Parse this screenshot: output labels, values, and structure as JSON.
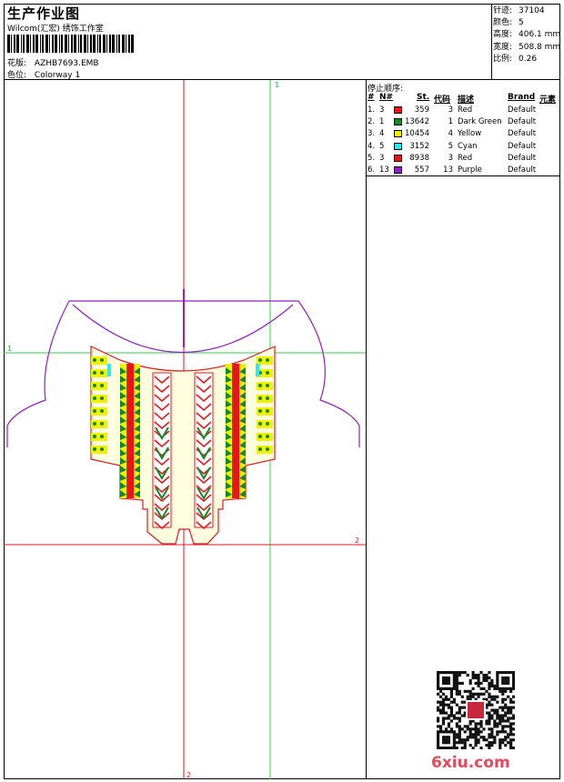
{
  "header": {
    "title": "生产作业图",
    "company": "Wilcom(汇宏) 绣饰工作室",
    "design_label": "花版:",
    "design_value": "AZHB7693.EMB",
    "color_label": "色位:",
    "color_value": "Colorway 1"
  },
  "stats": [
    {
      "label": "针迹:",
      "value": "37104"
    },
    {
      "label": "颜色:",
      "value": "5"
    },
    {
      "label": "高度:",
      "value": "406.1 mm"
    },
    {
      "label": "宽度:",
      "value": "508.8 mm"
    },
    {
      "label": "比例:",
      "value": "0.26"
    }
  ],
  "stop_sequence": {
    "title": "停止顺序:",
    "columns": [
      "#",
      "N#",
      "St.",
      "代码",
      "描述",
      "Brand",
      "元素"
    ],
    "rows": [
      {
        "idx": "1.",
        "needle": "3",
        "color": "#e8141a",
        "stitches": "359",
        "code": "3",
        "desc": "Red",
        "brand": "Default"
      },
      {
        "idx": "2.",
        "needle": "1",
        "color": "#14882c",
        "stitches": "13642",
        "code": "1",
        "desc": "Dark Green",
        "brand": "Default"
      },
      {
        "idx": "3.",
        "needle": "4",
        "color": "#f0f000",
        "stitches": "10454",
        "code": "4",
        "desc": "Yellow",
        "brand": "Default"
      },
      {
        "idx": "4.",
        "needle": "5",
        "color": "#30e8f0",
        "stitches": "3152",
        "code": "5",
        "desc": "Cyan",
        "brand": "Default"
      },
      {
        "idx": "5.",
        "needle": "3",
        "color": "#e8141a",
        "stitches": "8938",
        "code": "3",
        "desc": "Red",
        "brand": "Default"
      },
      {
        "idx": "6.",
        "needle": "13",
        "color": "#9020c0",
        "stitches": "557",
        "code": "13",
        "desc": "Purple",
        "brand": "Default"
      }
    ]
  },
  "guides": {
    "h1": "1",
    "h2": "2",
    "v1": "1",
    "v2": "2"
  },
  "watermark": "6xiu.com"
}
